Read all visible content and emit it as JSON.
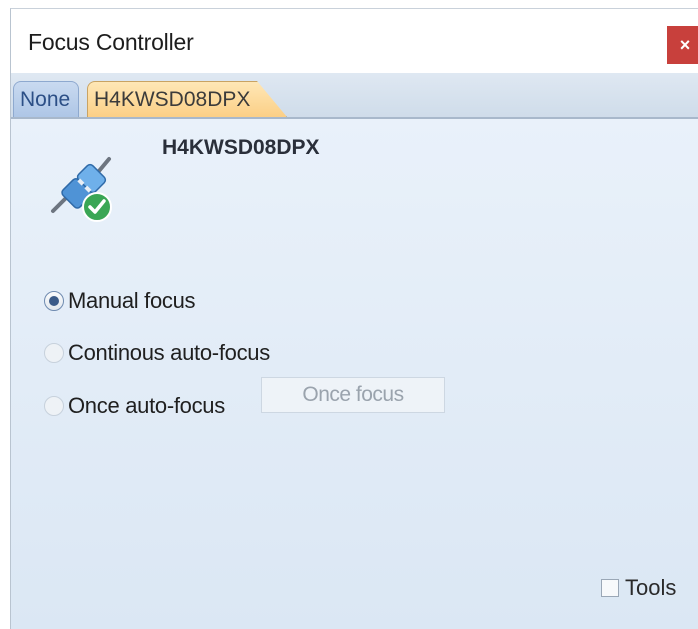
{
  "window": {
    "title": "Focus Controller",
    "close_glyph": "×"
  },
  "tabs": [
    {
      "label": "None",
      "active": false
    },
    {
      "label": "H4KWSD08DPX",
      "active": true
    }
  ],
  "device": {
    "name": "H4KWSD08DPX",
    "icon": "plug-connected-icon",
    "status": "connected"
  },
  "focus_modes": [
    {
      "label": "Manual focus",
      "selected": true,
      "enabled": true
    },
    {
      "label": "Continous auto-focus",
      "selected": false,
      "enabled": false
    },
    {
      "label": "Once auto-focus",
      "selected": false,
      "enabled": false
    }
  ],
  "once_focus_button": {
    "label": "Once focus",
    "enabled": false
  },
  "tools": {
    "label": "Tools",
    "checked": false
  },
  "colors": {
    "close": "#c8403c",
    "active_tab": "#fbcf86",
    "panel": "#e3edf7",
    "check": "#3aa655"
  }
}
